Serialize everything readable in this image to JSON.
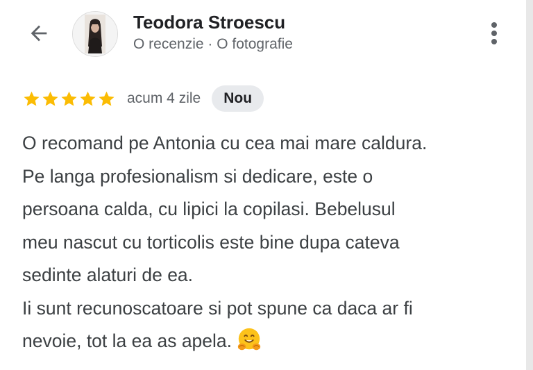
{
  "header": {
    "back_icon": "arrow-back-icon",
    "more_icon": "more-vert-icon",
    "user": {
      "name": "Teodora Stroescu",
      "meta": "O recenzie · O fotografie",
      "avatar": "profile-photo"
    }
  },
  "review": {
    "rating": 5,
    "rating_max": 5,
    "star_color": "#fbbc04",
    "time": "acum 4 zile",
    "badge": "Nou",
    "lines": [
      "O recomand pe Antonia cu cea mai mare caldura.",
      "Pe langa profesionalism si dedicare, este o",
      "persoana calda, cu lipici la copilasi. Bebelusul",
      "meu nascut cu torticolis este bine dupa cateva",
      "sedinte alaturi de ea.",
      "Ii sunt recunoscatoare si pot spune ca daca ar fi",
      "nevoie, tot la ea as apela."
    ],
    "emoji": "hugging-face-emoji"
  }
}
